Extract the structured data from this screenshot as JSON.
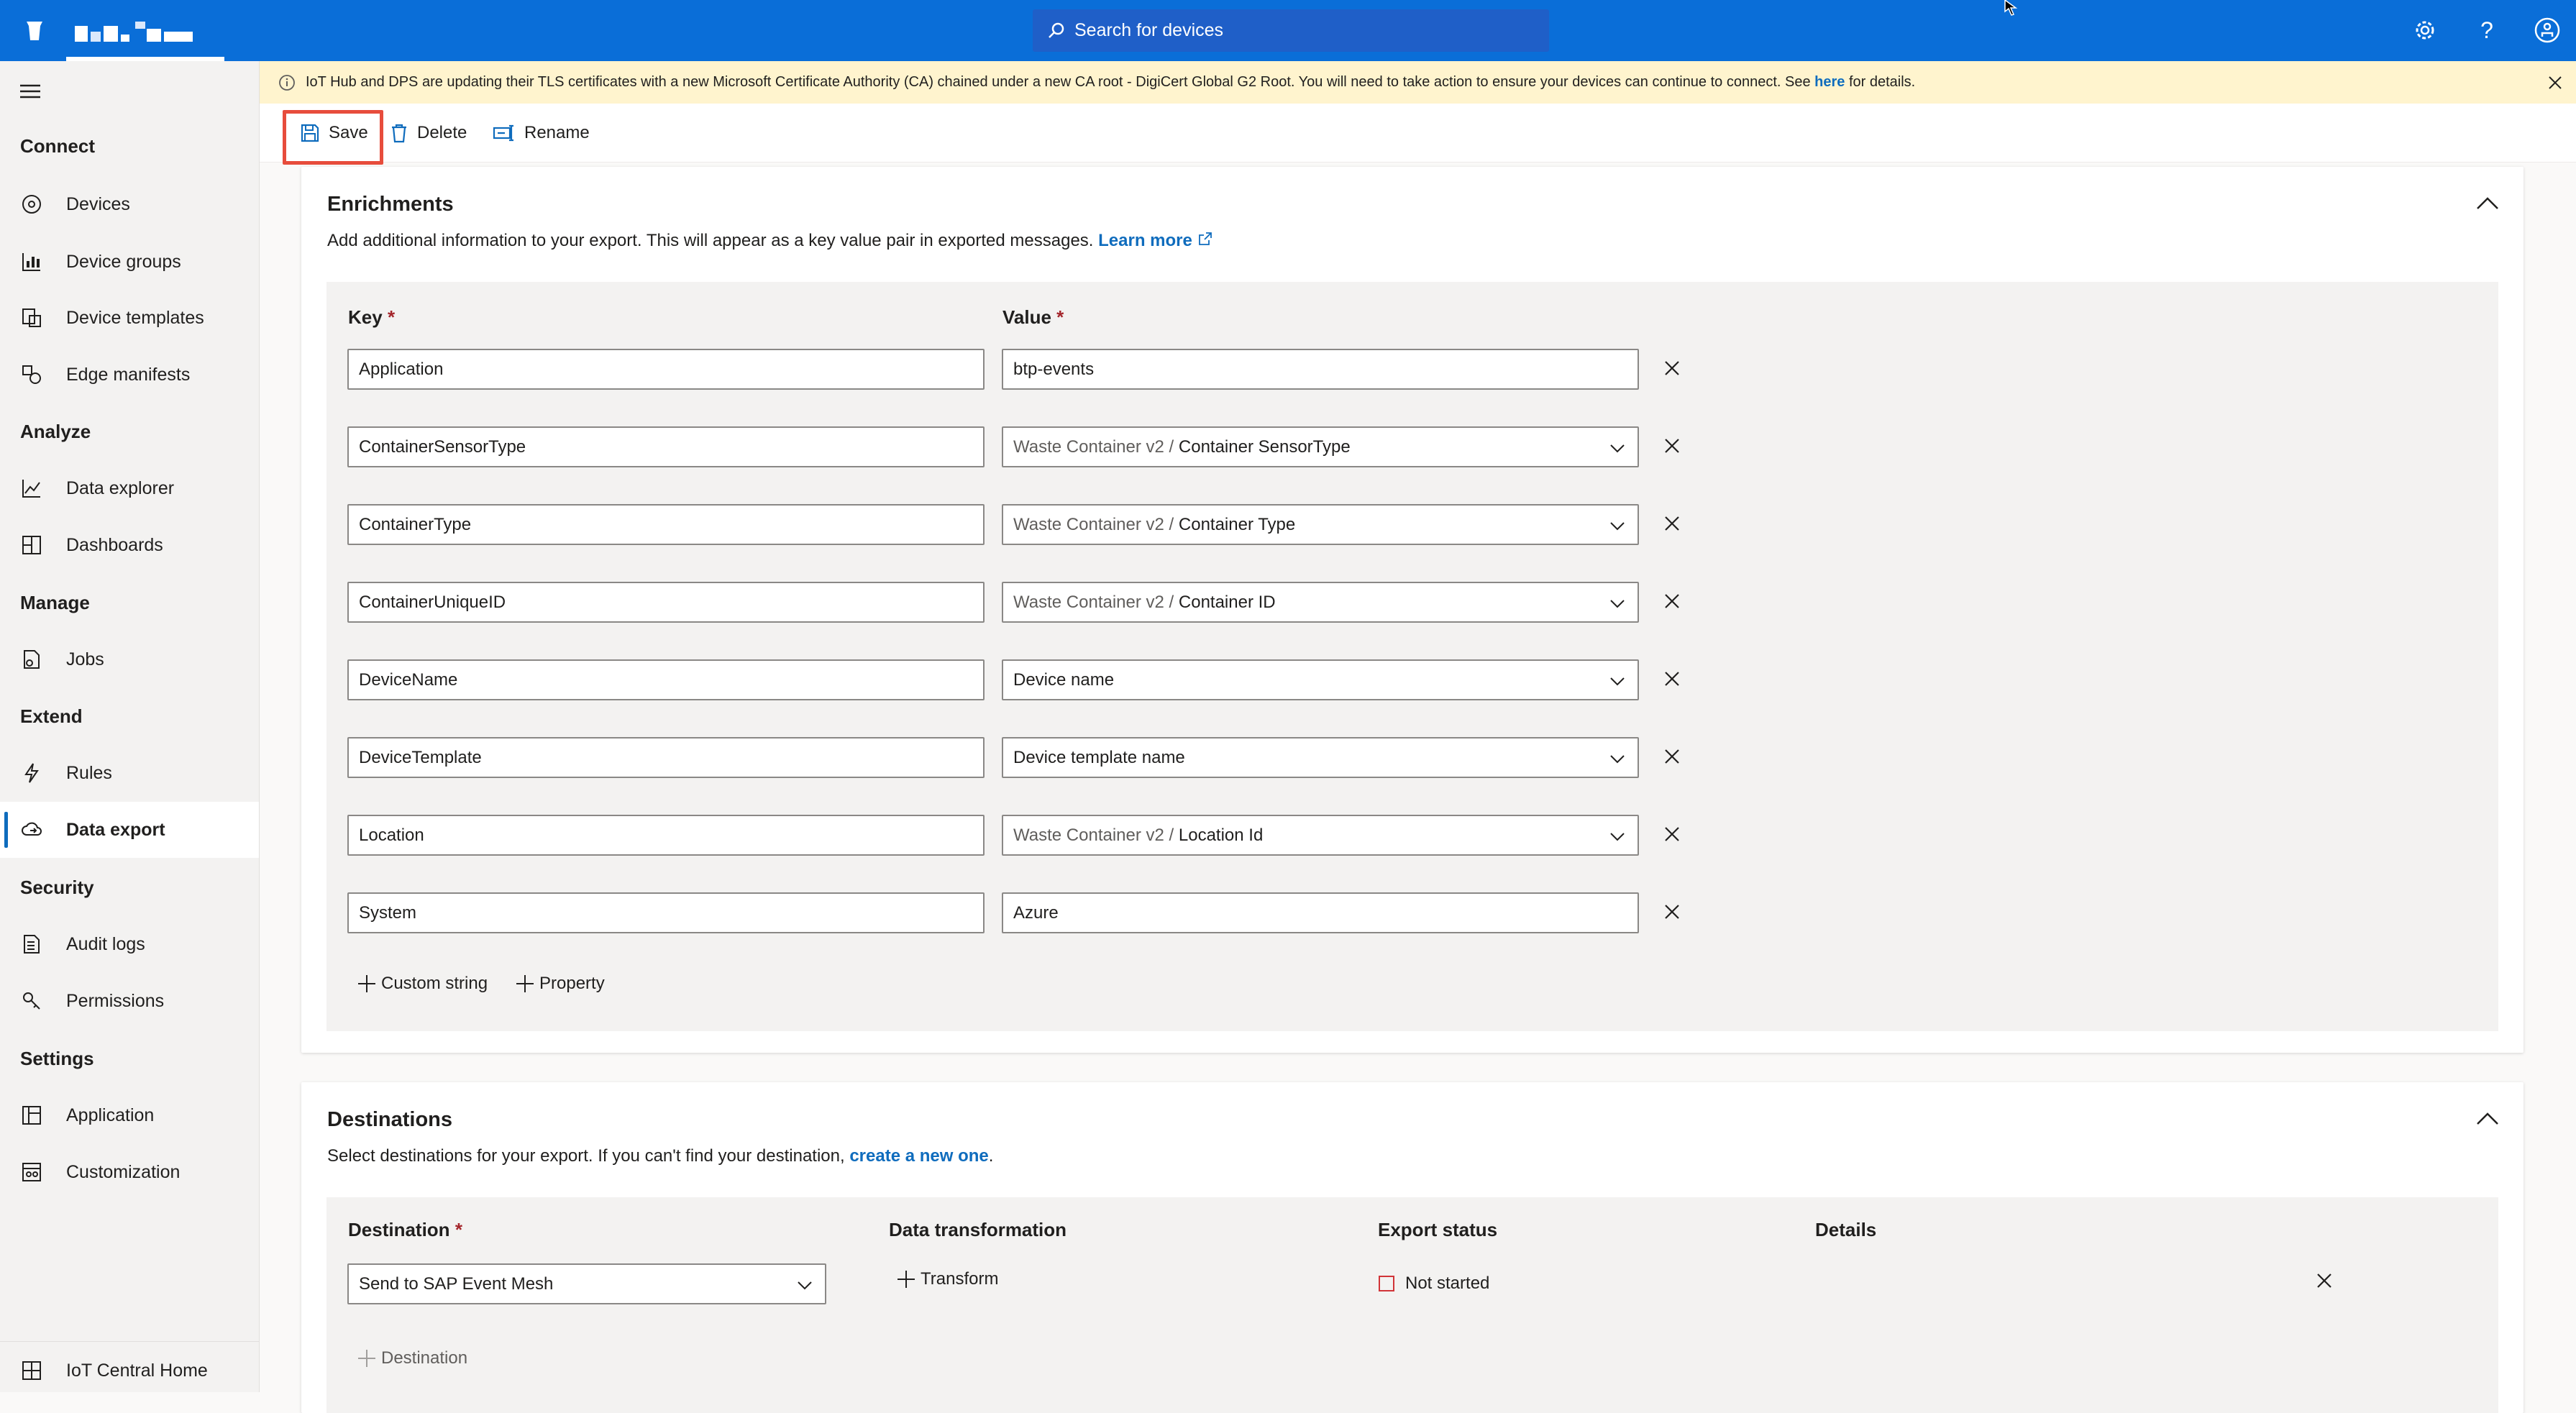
{
  "topbar": {
    "search_placeholder": "Search for devices"
  },
  "sidebar": {
    "groups": {
      "connect": "Connect",
      "analyze": "Analyze",
      "manage": "Manage",
      "extend": "Extend",
      "security": "Security",
      "settings": "Settings"
    },
    "items": {
      "devices": "Devices",
      "device_groups": "Device groups",
      "device_templates": "Device templates",
      "edge_manifests": "Edge manifests",
      "data_explorer": "Data explorer",
      "dashboards": "Dashboards",
      "jobs": "Jobs",
      "rules": "Rules",
      "data_export": "Data export",
      "audit_logs": "Audit logs",
      "permissions": "Permissions",
      "application": "Application",
      "customization": "Customization",
      "iot_central_home": "IoT Central Home"
    }
  },
  "banner": {
    "text": "IoT Hub and DPS are updating their TLS certificates with a new Microsoft Certificate Authority (CA) chained under a new CA root - DigiCert Global G2 Root. You will need to take action to ensure your devices can continue to connect. See ",
    "link": "here",
    "suffix": " for details."
  },
  "toolbar": {
    "save": "Save",
    "delete": "Delete",
    "rename": "Rename"
  },
  "enrichments": {
    "title": "Enrichments",
    "description": "Add additional information to your export. This will appear as a key value pair in exported messages.",
    "learn_more": "Learn more",
    "key_label": "Key",
    "value_label": "Value",
    "required_mark": "*",
    "rows": [
      {
        "key": "Application",
        "value_prefix": "",
        "value": "btp-events"
      },
      {
        "key": "ContainerSensorType",
        "value_prefix": "Waste Container v2 /",
        "value": "Container SensorType"
      },
      {
        "key": "ContainerType",
        "value_prefix": "Waste Container v2 /",
        "value": "Container Type"
      },
      {
        "key": "ContainerUniqueID",
        "value_prefix": "Waste Container v2 /",
        "value": "Container ID"
      },
      {
        "key": "DeviceName",
        "value_prefix": "",
        "value": "Device name"
      },
      {
        "key": "DeviceTemplate",
        "value_prefix": "",
        "value": "Device template name"
      },
      {
        "key": "Location",
        "value_prefix": "Waste Container v2 /",
        "value": "Location Id"
      },
      {
        "key": "System",
        "value_prefix": "",
        "value": "Azure"
      }
    ],
    "add_custom_string": "Custom string",
    "add_property": "Property"
  },
  "destinations": {
    "title": "Destinations",
    "description_prefix": "Select destinations for your export. If you can't find your destination,",
    "description_link": "create a new one",
    "description_suffix": ".",
    "col_destination": "Destination",
    "col_transformation": "Data transformation",
    "col_status": "Export status",
    "col_details": "Details",
    "required_mark": "*",
    "destination_value": "Send to SAP Event Mesh",
    "transform_label": "Transform",
    "status_text": "Not started",
    "add_destination": "Destination"
  },
  "colors": {
    "topbar": "#0a6ed8",
    "accent": "#0f6cbd",
    "highlight": "#e74c3c",
    "banner": "#fff4ce",
    "status_not_started": "#d13438"
  }
}
